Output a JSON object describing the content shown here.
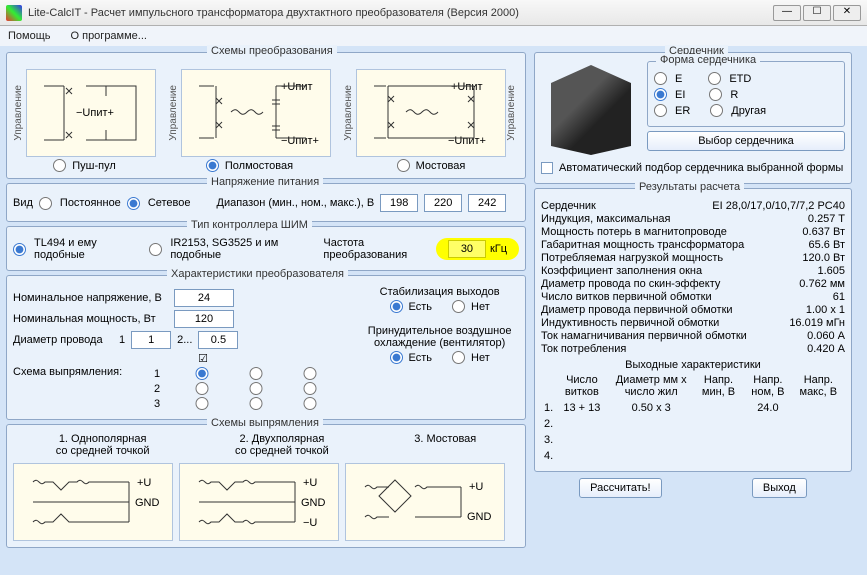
{
  "window": {
    "title": "Lite-CalcIT - Расчет импульсного трансформатора двухтактного преобразователя (Версия 2000)",
    "min": "—",
    "max": "☐",
    "close": "✕"
  },
  "menu": {
    "help": "Помощь",
    "about": "О программе..."
  },
  "conversion": {
    "title": "Схемы  преобразования",
    "mgmt": "Управление",
    "pushpull": "Пуш-пул",
    "halfbridge": "Полмостовая",
    "bridge": "Мостовая",
    "upit_plus": "+Uпит",
    "upit_neg": "−Uпит+"
  },
  "supply": {
    "title": "Напряжение питания",
    "kind": "Вид",
    "dc": "Постоянное",
    "mains": "Сетевое",
    "range_label": "Диапазон (мин., ном., макс.), В",
    "min": "198",
    "nom": "220",
    "max": "242"
  },
  "pwm": {
    "title": "Тип контроллера ШИМ",
    "tl494": "TL494 и ему подобные",
    "ir2153": "IR2153, SG3525 и им подобные",
    "freq_label": "Частота преобразования",
    "freq": "30",
    "unit": "кГц"
  },
  "params": {
    "title": "Характеристики преобразователя",
    "vnom": "Номинальное напряжение, В",
    "vnom_v": "24",
    "pnom": "Номинальная мощность, Вт",
    "pnom_v": "120",
    "dwire": "Диаметр провода",
    "d1": "1",
    "d1_v": "1",
    "d2": "2...",
    "d2_v": "0.5",
    "rect_scheme": "Схема выпрямления:",
    "c1": "1",
    "c2": "2",
    "c3": "3",
    "stab": "Стабилизация выходов",
    "yes": "Есть",
    "no": "Нет",
    "fan": "Принудительное воздушное охлаждение (вентилятор)"
  },
  "rect": {
    "title": "Схемы выпрямления",
    "s1a": "1. Однополярная",
    "s1b": "со средней точкой",
    "s2a": "2. Двухполярная",
    "s2b": "со средней точкой",
    "s3a": "3. Мостовая",
    "pu": "+U",
    "gnd": "GND",
    "mu": "−U"
  },
  "core": {
    "title": "Сердечник",
    "shape": "Форма сердечника",
    "E": "E",
    "ETD": "ETD",
    "EI": "EI",
    "R": "R",
    "ER": "ER",
    "other": "Другая",
    "choose": "Выбор сердечника",
    "auto": "Автоматический подбор сердечника выбранной формы"
  },
  "results": {
    "title": "Результаты расчета",
    "core_k": "Сердечник",
    "core_v": "EI 28,0/17,0/10,7/7,2 PC40",
    "bmax_k": "Индукция, максимальная",
    "bmax_v": "0.257 T",
    "ploss_k": "Мощность потерь в магнитопроводе",
    "ploss_v": "0.637 Вт",
    "pgab_k": "Габаритная мощность трансформатора",
    "pgab_v": "65.6 Вт",
    "plm_k": "Потребляемая нагрузкой мощность",
    "plm_v": "120.0 Вт",
    "kz_k": "Коэффициент заполнения окна",
    "kz_v": "1.605",
    "dskin_k": "Диаметр провода по скин-эффекту",
    "dskin_v": "0.762 мм",
    "n1_k": "Число витков первичной обмотки",
    "n1_v": "61",
    "d1_k": "Диаметр провода первичной обмотки",
    "d1_v": "1.00 x 1",
    "l1_k": "Индуктивность первичной обмотки",
    "l1_v": "16.019 мГн",
    "imag_k": "Ток намагничивания первичной обмотки",
    "imag_v": "0.060 А",
    "icons_k": "Ток потребления",
    "icons_v": "0.420 А",
    "out_title": "Выходные характеристики",
    "h1": "Число витков",
    "h2": "Диаметр мм х число жил",
    "h3": "Напр. мин, В",
    "h4": "Напр. ном, В",
    "h5": "Напр. макс, В",
    "r1_n": "1.",
    "r1_t": "13 + 13",
    "r1_d": "0.50 x 3",
    "r1_min": "",
    "r1_nom": "24.0",
    "r1_max": "",
    "r2_n": "2.",
    "r3_n": "3.",
    "r4_n": "4."
  },
  "buttons": {
    "calc": "Рассчитать!",
    "exit": "Выход"
  }
}
